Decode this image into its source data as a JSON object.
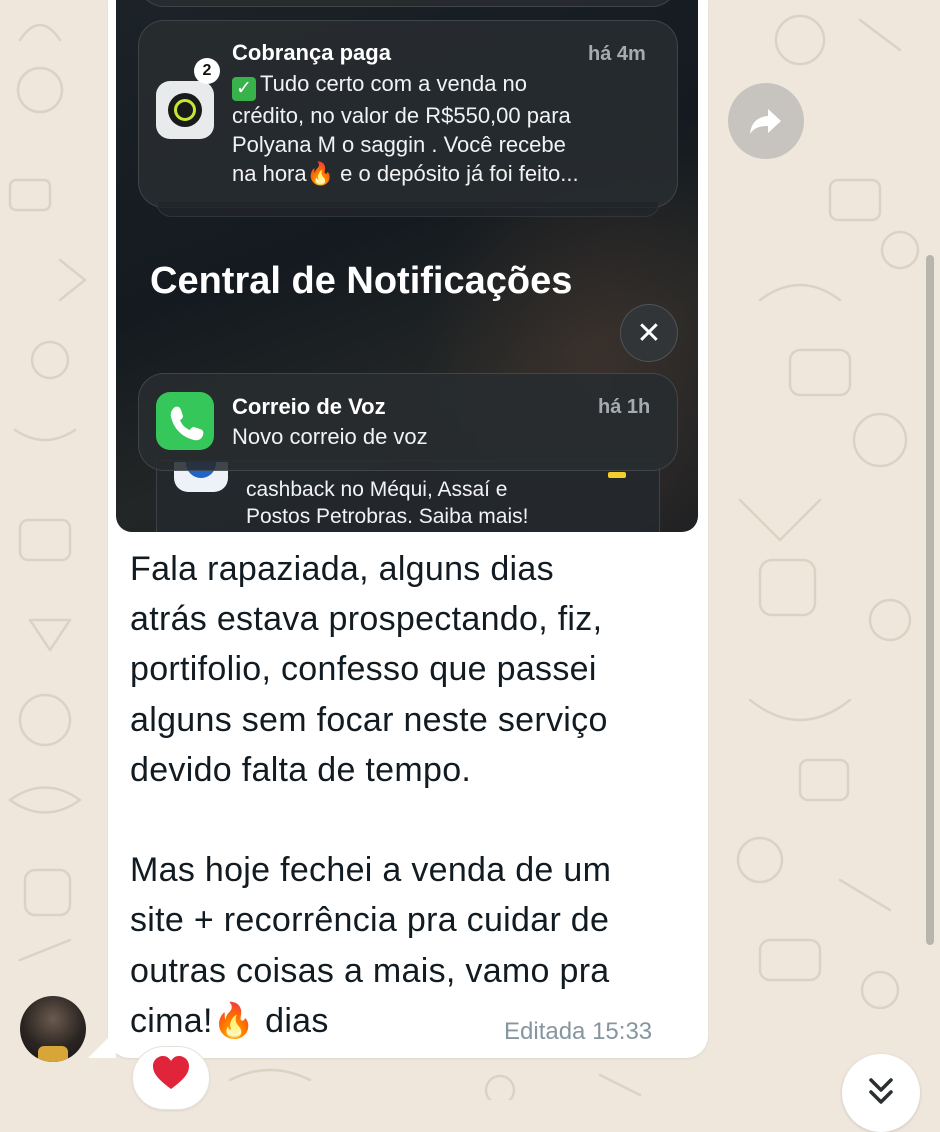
{
  "colors": {
    "wallpaper": "#efe7dc",
    "bubble": "#ffffff",
    "message_text": "#111b21",
    "meta_text": "#8696a0",
    "reaction_heart": "#e0243a"
  },
  "screenshot": {
    "payment_notification": {
      "title": "Cobrança paga",
      "time": "há 4m",
      "badge_count": "2",
      "check_icon": "check-mark-button",
      "body_line1": "Tudo certo com a venda no",
      "body_line2": "crédito, no valor de R$550,00 para",
      "body_line3": "Polyana M o saggin . Você recebe",
      "body_line4_start": "na hora",
      "body_line4_emoji": "🔥",
      "body_line4_end": " e o depósito já foi feito..."
    },
    "section_title": "Central de Notificações",
    "close_icon_glyph": "✕",
    "voicemail_notification": {
      "title": "Correio de Voz",
      "time": "há 1h",
      "body": "Novo correio de voz"
    },
    "promo_notification": {
      "line1": "cashback no Méqui, Assaí e",
      "line2": "Postos Petrobras. Saiba mais!"
    }
  },
  "message": {
    "text": "Fala rapaziada, alguns dias\natrás estava prospectando, fiz,\nportifolio, confesso que passei\nalguns sem focar neste serviço\ndevido falta de tempo.\n\nMas hoje fechei a venda de um\nsite + recorrência pra cuidar de\noutras coisas a mais, vamo pra\ncima!🔥 dias",
    "edited_label": "Editada",
    "time": "15:33"
  },
  "reaction": {
    "emoji": "❤️"
  },
  "icons": {
    "forward": "forward-arrow-icon",
    "avatar": "sender-avatar",
    "scroll_down": "double-chevron-down-icon"
  }
}
